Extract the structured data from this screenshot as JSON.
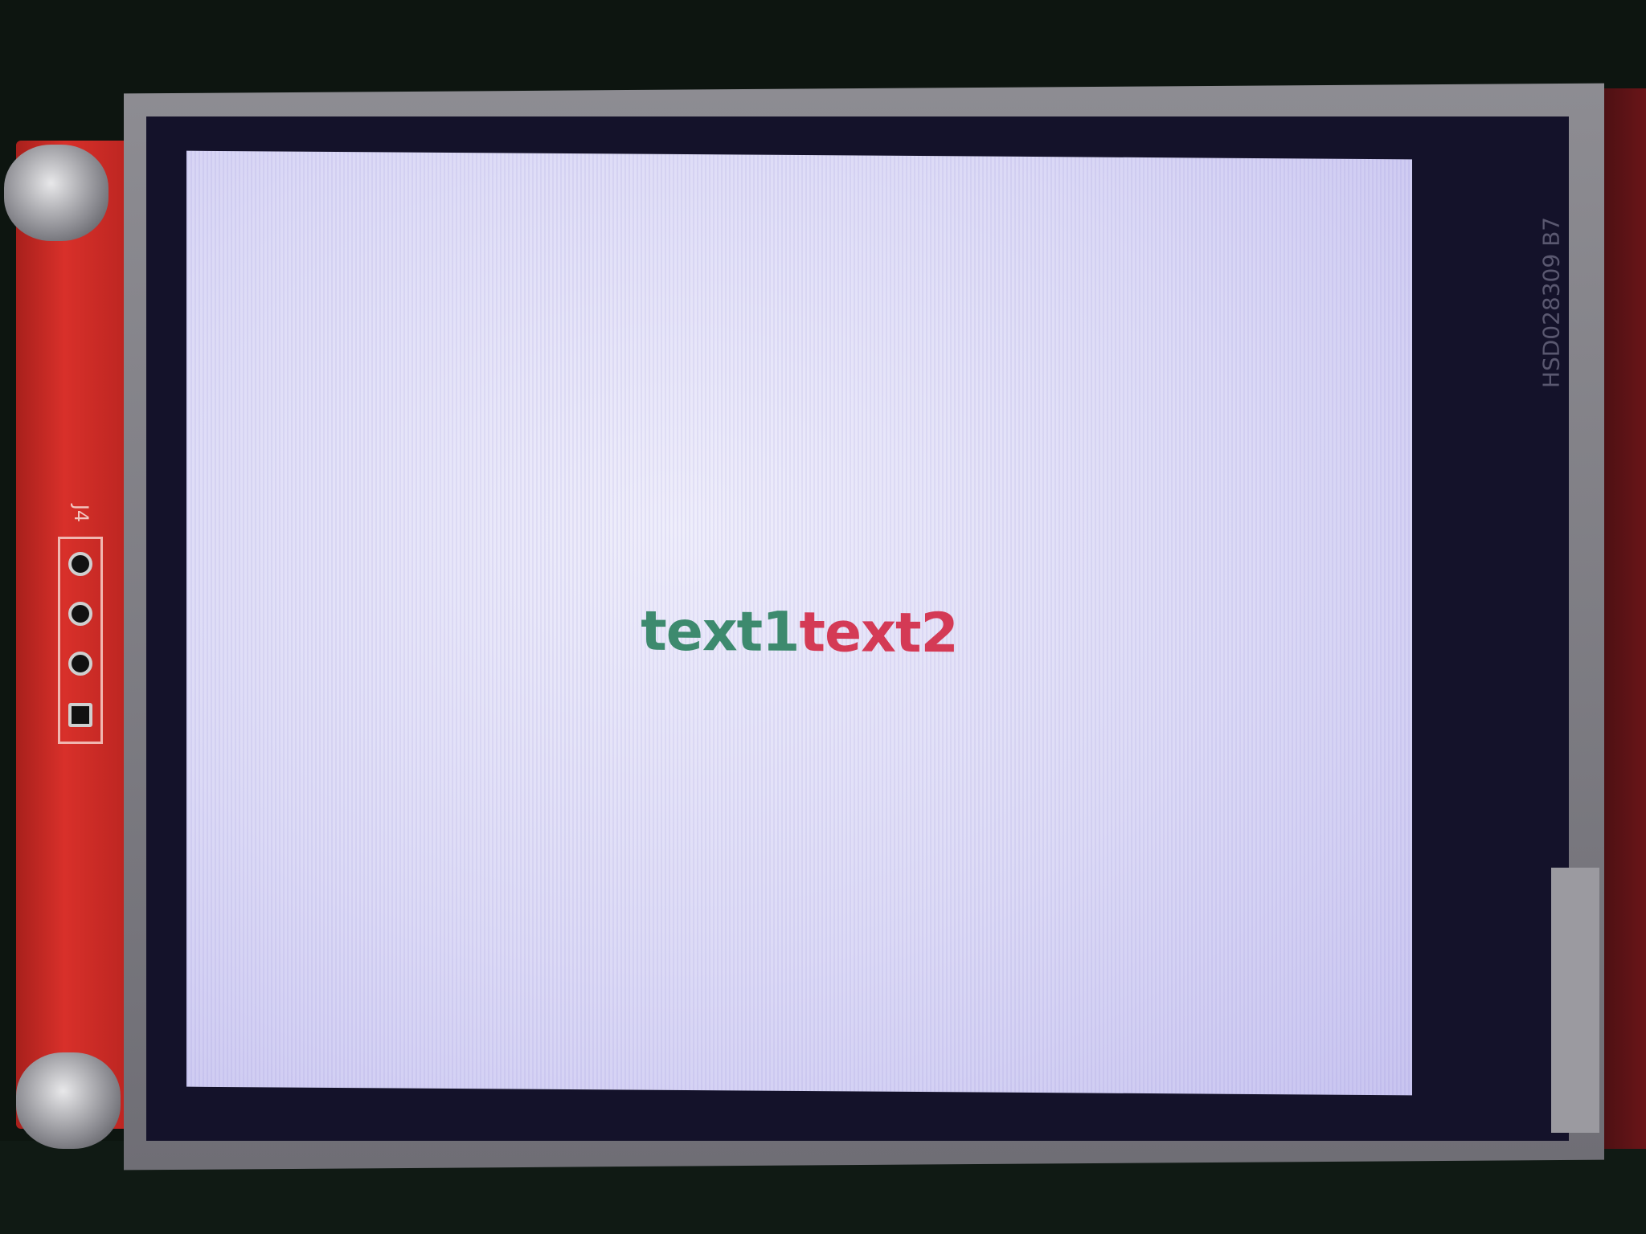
{
  "display": {
    "text1": "text1",
    "text2": "text2",
    "text1_color": "#3d8a6e",
    "text2_color": "#d43a55",
    "background_color": "#dcdaf6"
  },
  "board": {
    "model_label": "HSD028309 B7",
    "header_label": "J4"
  }
}
